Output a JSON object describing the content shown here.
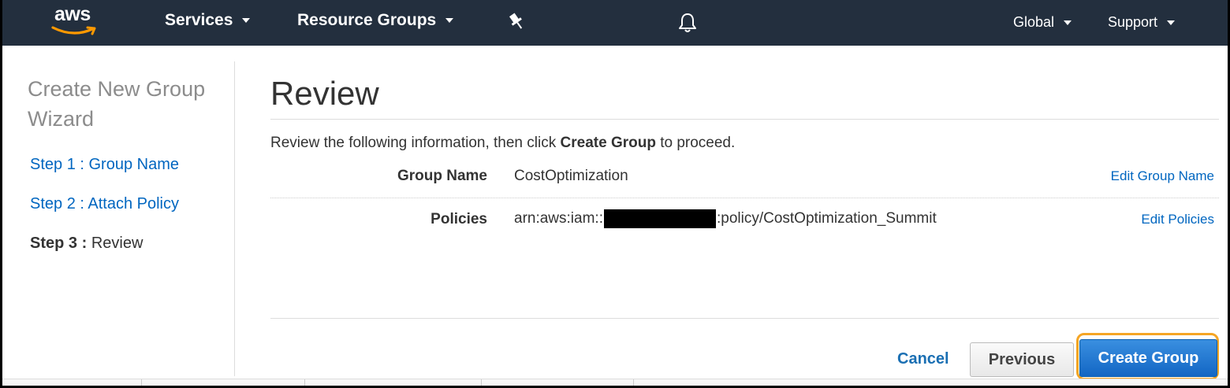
{
  "navbar": {
    "logo_text": "aws",
    "services": "Services",
    "resource_groups": "Resource Groups",
    "pin_icon": "pin-icon",
    "bell_icon": "bell-icon",
    "region": "Global",
    "support": "Support"
  },
  "sidebar": {
    "title": "Create New Group Wizard",
    "steps": [
      {
        "number": "Step 1 :",
        "label": "Group Name"
      },
      {
        "number": "Step 2 :",
        "label": "Attach Policy"
      },
      {
        "number": "Step 3 :",
        "label": "Review"
      }
    ]
  },
  "main": {
    "title": "Review",
    "intro_prefix": "Review the following information, then click ",
    "intro_bold": "Create Group",
    "intro_suffix": " to proceed.",
    "rows": [
      {
        "label": "Group Name",
        "value": "CostOptimization",
        "edit": "Edit Group Name"
      },
      {
        "label": "Policies",
        "value_prefix": "arn:aws:iam::",
        "value_suffix": ":policy/CostOptimization_Summit",
        "edit": "Edit Policies"
      }
    ]
  },
  "footer": {
    "cancel": "Cancel",
    "previous": "Previous",
    "create": "Create Group"
  },
  "colors": {
    "navbar": "#232f3e",
    "link": "#0066c0",
    "primary_button": "#1266c4",
    "highlight_ring": "#f5a524"
  }
}
